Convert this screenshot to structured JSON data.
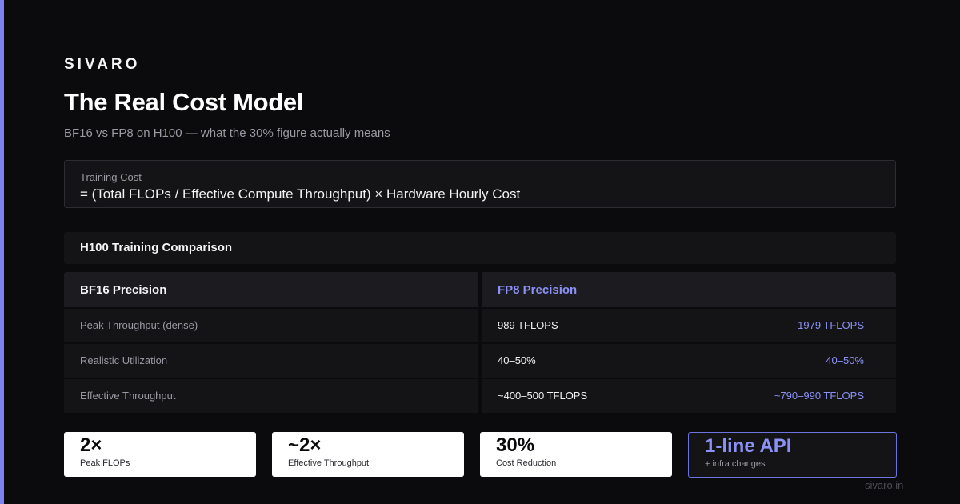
{
  "brand": "SIVARO",
  "title": "The Real Cost Model",
  "subtitle": "BF16 vs FP8 on H100 — what the 30% figure actually means",
  "formula": {
    "label": "Training Cost",
    "text": "= (Total FLOPs / Effective Compute Throughput) × Hardware Hourly Cost"
  },
  "comparison": {
    "title": "H100 Training Comparison",
    "columns": [
      "BF16 Precision",
      "FP8 Precision"
    ],
    "rows": [
      {
        "label": "Peak Throughput (dense)",
        "bf16": "989 TFLOPS",
        "fp8": "1979 TFLOPS"
      },
      {
        "label": "Realistic Utilization",
        "bf16": "40–50%",
        "fp8": "40–50%"
      },
      {
        "label": "Effective Throughput",
        "bf16": "~400–500 TFLOPS",
        "fp8": "~790–990 TFLOPS"
      }
    ]
  },
  "stats": [
    {
      "value": "2×",
      "label": "Peak FLOPs"
    },
    {
      "value": "~2×",
      "label": "Effective Throughput"
    },
    {
      "value": "30%",
      "label": "Cost Reduction"
    },
    {
      "value": "1-line API",
      "label": "+ infra changes"
    }
  ],
  "footer_url": "sivaro.in",
  "colors": {
    "accent": "#7c83f0",
    "background": "#0b0b0d",
    "panel": "#141417",
    "accent_text": "#8b91f5"
  }
}
